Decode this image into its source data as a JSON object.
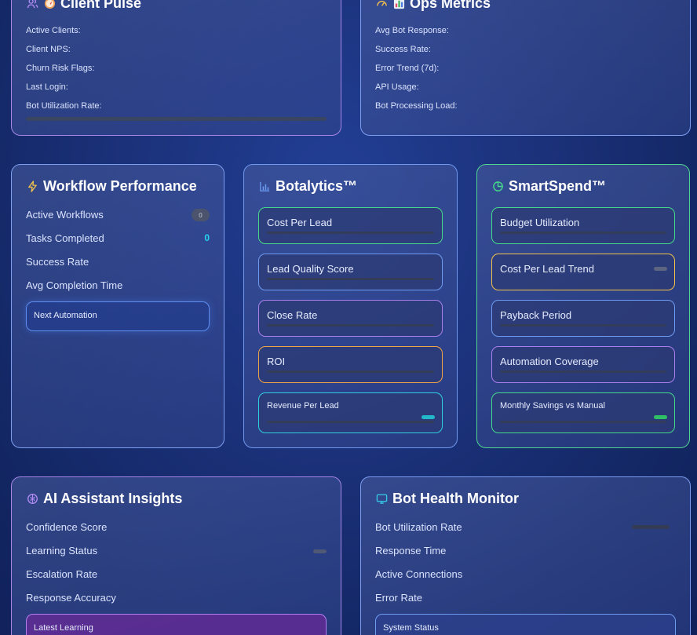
{
  "client_pulse": {
    "title": "Client Pulse",
    "rows": [
      "Active Clients:",
      "Client NPS:",
      "Churn Risk Flags:",
      "Last Login:",
      "Bot Utilization Rate:"
    ]
  },
  "ops_metrics": {
    "title": "Ops Metrics",
    "rows": [
      "Avg Bot Response:",
      "Success Rate:",
      "Error Trend (7d):",
      "API Usage:",
      "Bot Processing Load:"
    ]
  },
  "workflow": {
    "title": "Workflow Performance",
    "rows": [
      "Active Workflows",
      "Tasks Completed",
      "Success Rate",
      "Avg Completion Time"
    ],
    "active_badge": "0",
    "tasks_value": "0",
    "next_label": "Next Automation"
  },
  "botalytics": {
    "title": "Botalytics™",
    "items": [
      "Cost Per Lead",
      "Lead Quality Score",
      "Close Rate",
      "ROI",
      "Revenue Per Lead"
    ]
  },
  "smartspend": {
    "title": "SmartSpend™",
    "items": [
      "Budget Utilization",
      "Cost Per Lead Trend",
      "Payback Period",
      "Automation Coverage",
      "Monthly Savings vs Manual"
    ]
  },
  "ai_insights": {
    "title": "AI Assistant Insights",
    "rows": [
      "Confidence Score",
      "Learning Status",
      "Escalation Rate",
      "Response Accuracy"
    ],
    "latest_label": "Latest Learning"
  },
  "bot_health": {
    "title": "Bot Health Monitor",
    "rows": [
      "Bot Utilization Rate",
      "Response Time",
      "Active Connections",
      "Error Rate"
    ],
    "status_label": "System Status"
  },
  "colors": {
    "green": "#45d98a",
    "blue": "#6d9cf2",
    "purple": "#a97ff0",
    "orange": "#f0a349",
    "cyan": "#30cfe0",
    "yellow": "#f3c24b"
  }
}
